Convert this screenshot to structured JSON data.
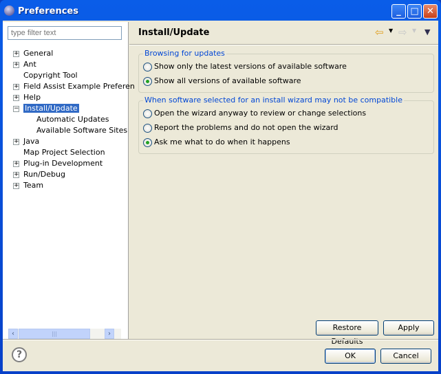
{
  "window": {
    "title": "Preferences",
    "minimize_icon": "minimize-icon",
    "maximize_icon": "maximize-icon",
    "close_icon": "close-icon"
  },
  "filter": {
    "placeholder": "type filter text"
  },
  "tree": {
    "items": [
      {
        "label": "General",
        "expander": "+"
      },
      {
        "label": "Ant",
        "expander": "+"
      },
      {
        "label": "Copyright Tool",
        "expander": ""
      },
      {
        "label": "Field Assist Example Preferen",
        "expander": "+"
      },
      {
        "label": "Help",
        "expander": "+"
      },
      {
        "label": "Install/Update",
        "expander": "-",
        "selected": true
      },
      {
        "label": "Automatic Updates",
        "expander": "",
        "child": true
      },
      {
        "label": "Available Software Sites",
        "expander": "",
        "child": true
      },
      {
        "label": "Java",
        "expander": "+"
      },
      {
        "label": "Map Project Selection",
        "expander": ""
      },
      {
        "label": "Plug-in Development",
        "expander": "+"
      },
      {
        "label": "Run/Debug",
        "expander": "+"
      },
      {
        "label": "Team",
        "expander": "+"
      }
    ]
  },
  "page": {
    "title": "Install/Update",
    "groups": [
      {
        "legend": "Browsing for updates",
        "options": [
          {
            "label": "Show only the latest versions of available software",
            "checked": false
          },
          {
            "label": "Show all versions of available software",
            "checked": true
          }
        ]
      },
      {
        "legend": "When software selected for an install wizard may not be compatible",
        "options": [
          {
            "label": "Open the wizard anyway to review or change selections",
            "checked": false
          },
          {
            "label": "Report the problems and do not open the wizard",
            "checked": false
          },
          {
            "label": "Ask me what to do when it happens",
            "checked": true
          }
        ]
      }
    ],
    "restore_defaults": "Restore Defaults",
    "apply": "Apply"
  },
  "footer": {
    "ok": "OK",
    "cancel": "Cancel",
    "help": "?"
  },
  "colors": {
    "titlebar": "#0a5de8",
    "selection": "#316ac5",
    "legend": "#0046d5"
  }
}
